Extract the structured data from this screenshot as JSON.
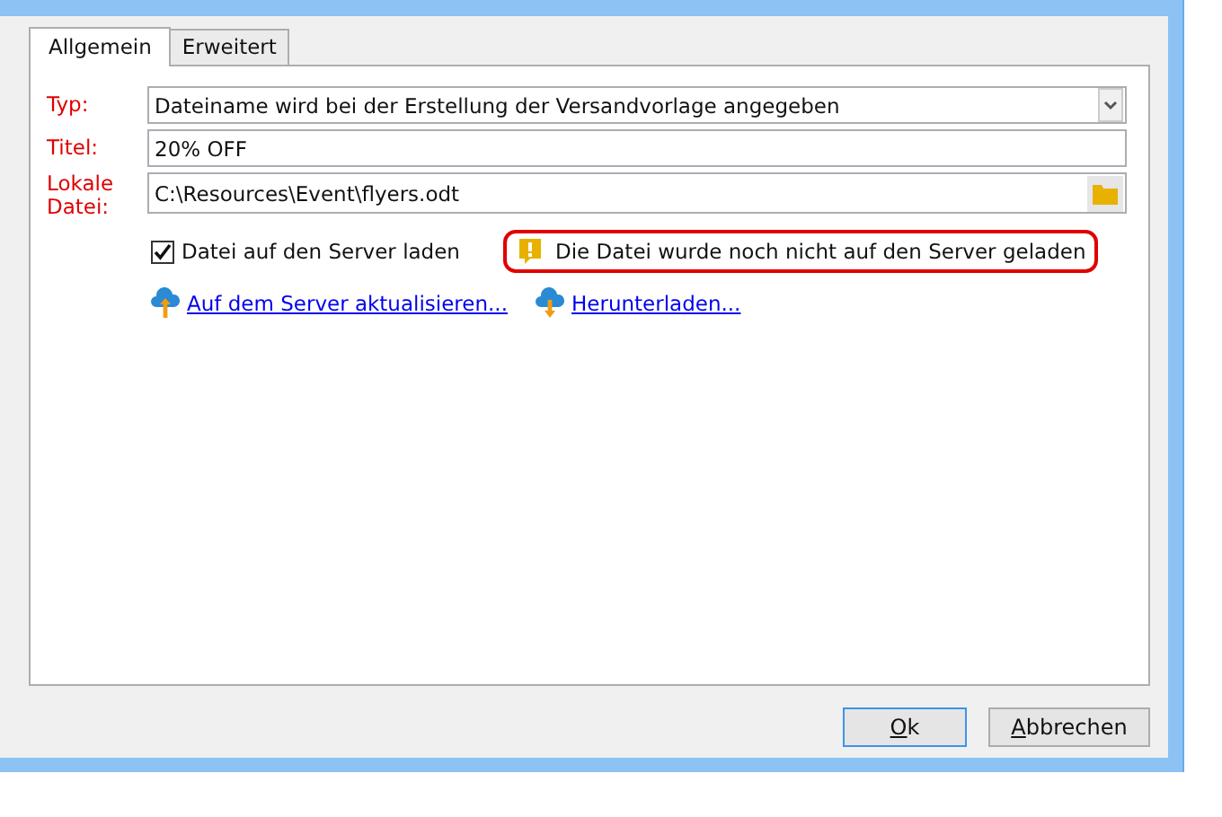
{
  "tabs": [
    {
      "label": "Allgemein",
      "selected": true
    },
    {
      "label": "Erweitert",
      "selected": false
    }
  ],
  "fields": [
    {
      "kind": "select",
      "label": "Typ:",
      "value": "Dateiname wird bei der Erstellung der Versandvorlage angegeben"
    },
    {
      "kind": "text",
      "label": "Titel:",
      "value": "20% OFF"
    },
    {
      "kind": "file",
      "label": "Lokale Datei:",
      "value": "C:\\Resources\\Event\\flyers.odt"
    }
  ],
  "upload_checkbox": {
    "label": "Datei auf den Server laden",
    "checked": true
  },
  "warning": "Die Datei wurde noch nicht auf den Server geladen",
  "links": [
    {
      "kind": "upload",
      "label": "Auf dem Server aktualisieren..."
    },
    {
      "kind": "download",
      "label": "Herunterladen..."
    }
  ],
  "buttons": [
    {
      "label": "Ok",
      "default": true
    },
    {
      "label": "Abbrechen",
      "default": false
    }
  ]
}
